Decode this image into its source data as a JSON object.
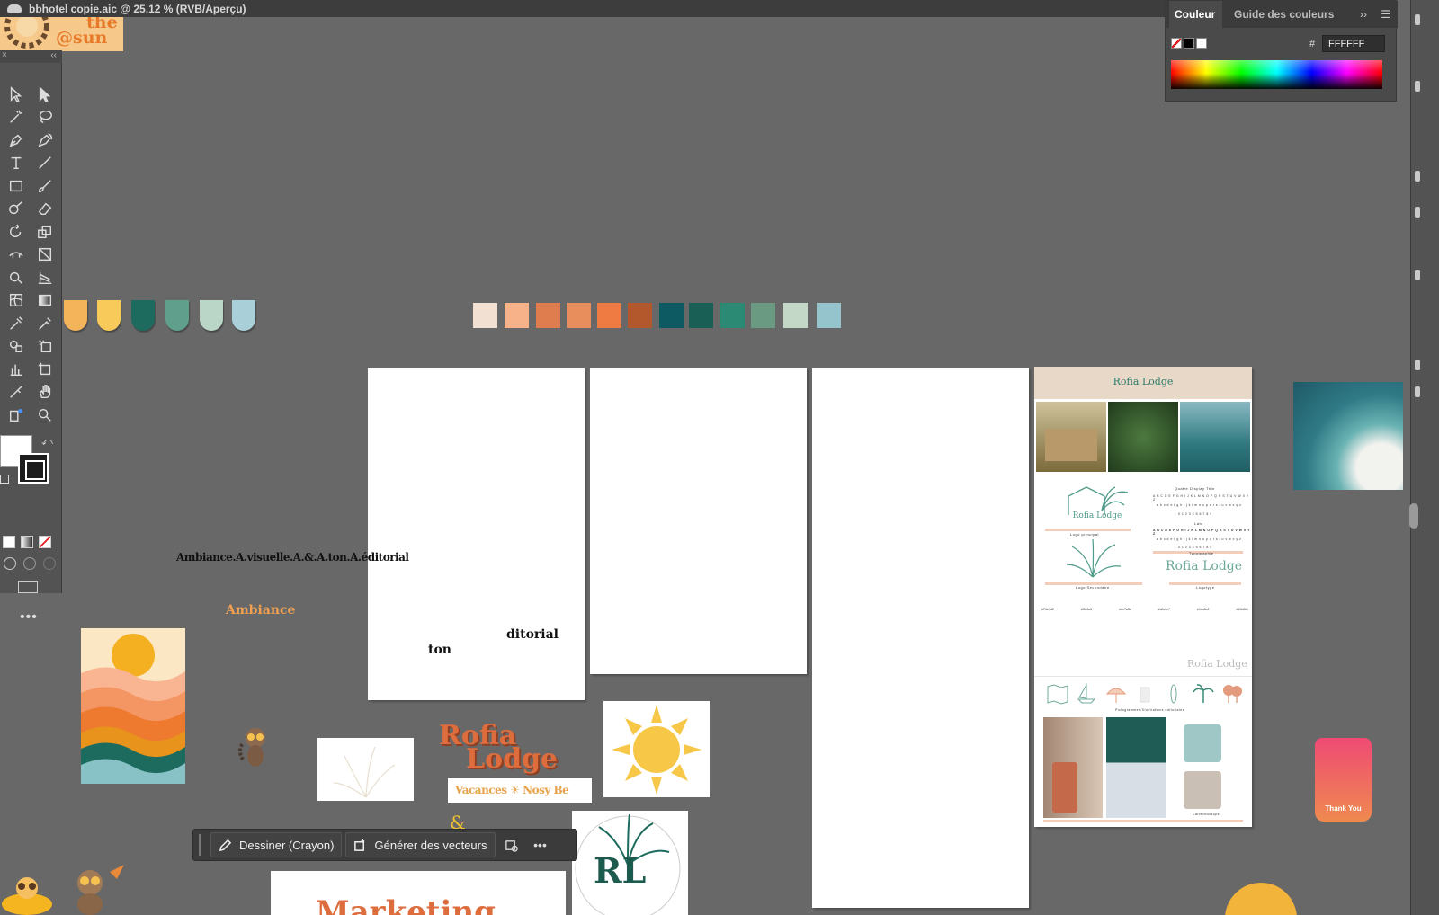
{
  "window": {
    "title": "bbhotel copie.aic @ 25,12 % (RVB/Aperçu)"
  },
  "logo_top": {
    "text_line1": "the",
    "text_line2": "sun"
  },
  "color_panel": {
    "tab_active": "Couleur",
    "tab_inactive": "Guide des couleurs",
    "hash_label": "#",
    "hex_value": "FFFFFF"
  },
  "canvas": {
    "label_ambiance_visuelle": "Ambiance.A.visuelle.A.&.A.ton.A.éditorial",
    "label_ambiance": "Ambiance",
    "label_ditorial": "ditorial",
    "label_ton": "ton",
    "rofia_line1": "Rofia",
    "rofia_line2": "Lodge",
    "vacances_text": "Vacances ☀ Nosy Be",
    "ampersand": "&",
    "marketing_text": "Marketing",
    "rl_monogram": "RL",
    "thank_you": "Thank You"
  },
  "brand_board": {
    "title": "Rofia Lodge",
    "font_name": "Quatre Display Thin",
    "upper_alphabet": "A B C D E F G H I J K L M N O P Q R S T U V W X Y Z",
    "lower_alphabet": "a b c d e f g h i j k l m n o p q r s t u v w x y z",
    "digits": "0 1 2 3 4 5 6 7 8 9",
    "font_name_2": "Lato",
    "logo_small": "Rofia Lodge",
    "logo_caption_1": "Logo principal",
    "logo_caption_2": "Logo Secondaire",
    "logo_caption_3": "Logotype",
    "typo_caption": "Typographie",
    "logotype": "Rofia Lodge",
    "color_codes": [
      "#F6e1d2",
      "#f8c0a3",
      "#de7a3d",
      "#a5c9c7",
      "#4da0a2",
      "#d0b8b1"
    ],
    "footer_logo": "Rofia Lodge",
    "illustration_caption": "Pictogrammes/Illustrations éditoriales",
    "mockup_caption": "Carte/Mockups"
  },
  "swatches_shapes": [
    "#f4b55a",
    "#f7ca5a",
    "#1d6b5e",
    "#5f9f8c",
    "#b9d6c6",
    "#a9cfd8"
  ],
  "swatches_squares": [
    "#f2e0d2",
    "#f8b28a",
    "#df7d4f",
    "#e88e5c",
    "#ef7b42",
    "#b3572d",
    "#0d5a63",
    "#1a5f55",
    "#2b8a74",
    "#6a9b82",
    "#c3d8c6",
    "#96c4cc"
  ],
  "context_bar": {
    "draw_label": "Dessiner (Crayon)",
    "generate_label": "Générer des vecteurs",
    "more": "•••"
  },
  "tools_panel": {
    "collapse": "‹‹",
    "close": "×",
    "more": "•••"
  }
}
